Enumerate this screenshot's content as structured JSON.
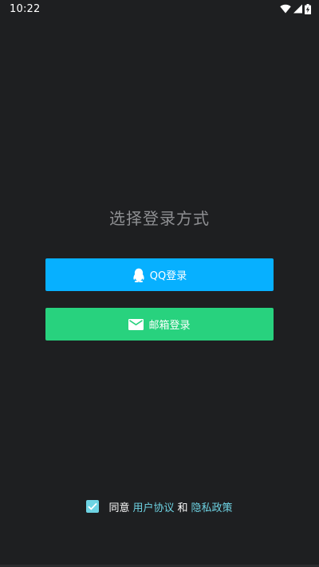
{
  "status_bar": {
    "time": "10:22",
    "icons": [
      "wifi-icon",
      "signal-icon",
      "battery-charging-icon"
    ]
  },
  "page": {
    "title": "选择登录方式"
  },
  "buttons": {
    "qq": {
      "label": "QQ登录",
      "icon": "qq-penguin-icon",
      "color": "#07b0ff"
    },
    "email": {
      "label": "邮箱登录",
      "icon": "mail-icon",
      "color": "#28d27e"
    }
  },
  "agreement": {
    "checked": true,
    "prefix": "同意",
    "user_agreement": "用户协议",
    "conjunction": "和",
    "privacy_policy": "隐私政策",
    "link_color": "#6ed3e3"
  },
  "colors": {
    "background": "#1e1f21",
    "title": "#8e8f92"
  }
}
